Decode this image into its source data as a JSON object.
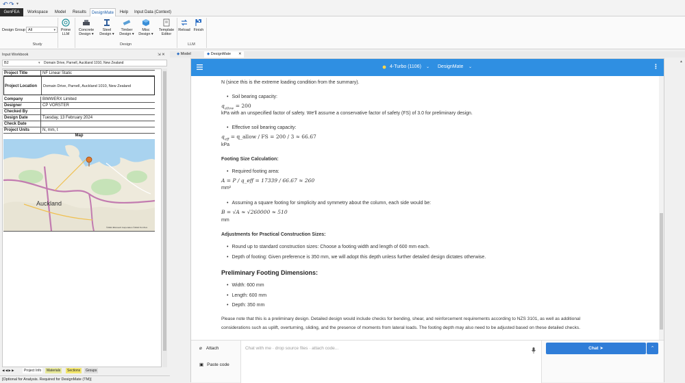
{
  "quick_access": {
    "undo": "↶",
    "redo": "↷",
    "more": "▾"
  },
  "tabs": [
    "GenFEA",
    "Workspace",
    "Model",
    "Results",
    "DesignMate",
    "Help",
    "Input Data (Context)"
  ],
  "ribbon": {
    "design_group_label": "Design Group",
    "design_group_value": "All",
    "buttons": {
      "prime_llm": [
        "Prime",
        "LLM"
      ],
      "concrete": [
        "Concrete",
        "Design ▾"
      ],
      "steel": [
        "Steel",
        "Design ▾"
      ],
      "timber": [
        "Timber",
        "Design ▾"
      ],
      "misc": [
        "Misc",
        "Design ▾"
      ],
      "template": [
        "Template",
        "Editor"
      ],
      "reload": "Reload",
      "finish": "Finish"
    },
    "groups": {
      "study": "Study",
      "design": "Design",
      "llm": "LLM"
    }
  },
  "workbook": {
    "title": "Input Workbook",
    "pin": "⇲ ✕",
    "cell_ref": "B2",
    "cell_value": "Domain Drive, Parnell, Auckland 1010, New Zealand",
    "rows": [
      {
        "k": "Project Title",
        "v": "NF Linear Static"
      },
      {
        "k": "Project Location",
        "v": "Domain Drive, Parnell, Auckland 1010, New Zealand"
      },
      {
        "k": "Company",
        "v": "BIMWERX Limited"
      },
      {
        "k": "Designer",
        "v": "CP VORSTER"
      },
      {
        "k": "Checked By",
        "v": ""
      },
      {
        "k": "Design Date",
        "v": "Tuesday, 13 February 2024"
      },
      {
        "k": "Check Date",
        "v": ""
      },
      {
        "k": "Project Units",
        "v": "N, mm, t"
      }
    ],
    "map_title": "Map",
    "map_labels": {
      "city": "Auckland",
      "copyright": "©2024 Microsoft Corporation  ©2024 TomTom"
    },
    "sheets": [
      "Project Info",
      "Materials",
      "Sections",
      "Groups"
    ],
    "sheet_nav": "◀ ◀ ▶ ▶",
    "status": "[Optional for Analysis. Required for DesignMate (TM)]"
  },
  "doc_tabs": [
    {
      "label": "Model"
    },
    {
      "label": "DesignMate",
      "close": "✕"
    }
  ],
  "app": {
    "model": "4-Turbo (1106)",
    "app_name": "DesignMate",
    "colors": {
      "primary": "#2f8fe2",
      "button": "#2f7dd8"
    },
    "content": {
      "n_line": "N (since this is the extreme loading condition from the summary).",
      "soil_bullet": "Soil bearing capacity:",
      "q_allow_lhs": "q",
      "q_allow_sub": "allow",
      "q_allow_rhs": "= 200",
      "kpa_line": "kPa with an unspecified factor of safety. We'll assume a conservative factor of safety (FS) of 3.0 for preliminary design.",
      "eff_bullet": "Effective soil bearing capacity:",
      "q_eff_expr": "= q_allow / FS = 200 / 3 ≈ 66.67",
      "kpa": "kPa",
      "fsc_heading": "Footing Size Calculation:",
      "req_area_bullet": "Required footing area:",
      "area_expr": "A = P / q_eff = 17339 / 66.67 ≈ 260",
      "mm2": "mm²",
      "square_bullet": "Assuming a square footing for simplicity and symmetry about the column, each side would be:",
      "b_expr": "B = √A ≈ √260000 ≈ 510",
      "mm": "mm",
      "adj_heading": "Adjustments for Practical Construction Sizes:",
      "round_bullet": "Round up to standard construction sizes: Choose a footing width and length of 600 mm each.",
      "depth_bullet": "Depth of footing: Given preference is 350 mm, we will adopt this depth unless further detailed design dictates otherwise.",
      "prelim_heading": "Preliminary Footing Dimensions:",
      "width_item": "Width: 600 mm",
      "length_item": "Length: 600 mm",
      "depth_item": "Depth: 350 mm",
      "note_line1": "Please note that this is a preliminary design. Detailed design would include checks for bending, shear, and reinforcement requirements according to NZS 3101, as well as additional",
      "note_line2": "considerations such as uplift, overturning, sliding, and the presence of moments from lateral loads. The footing depth may also need to be adjusted based on these detailed checks."
    },
    "composer": {
      "attach": "Attach",
      "paste_code": "Paste code",
      "placeholder": "Chat with me · drop source files · attach code...",
      "chat_button": "Chat"
    }
  }
}
